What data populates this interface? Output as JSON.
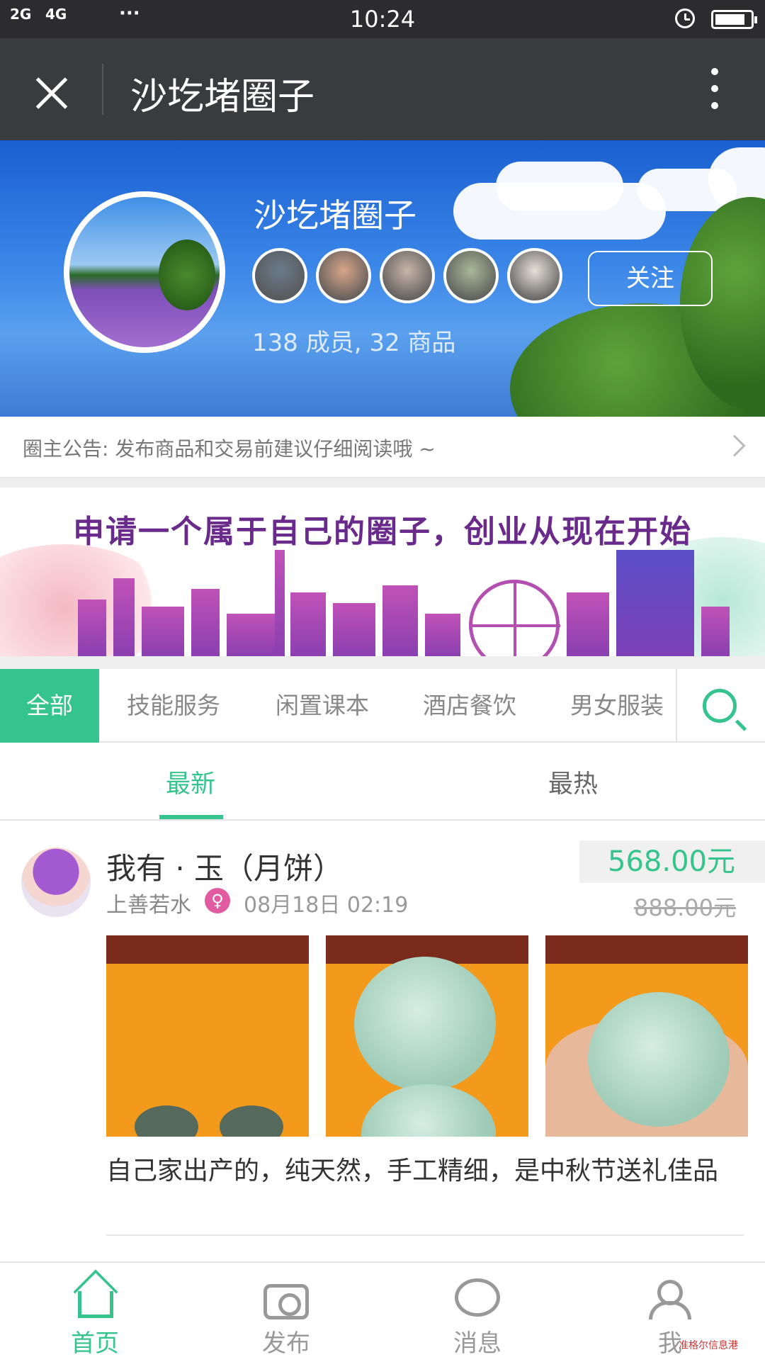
{
  "status_bar": {
    "signal_1": "2G",
    "signal_2": "4G",
    "dots": "···",
    "time": "10:24",
    "battery_level": 0.85
  },
  "title_bar": {
    "title": "沙圪堵圈子"
  },
  "hero": {
    "name": "沙圪堵圈子",
    "follow_label": "关注",
    "stats": "138 成员, 32 商品",
    "member_colors": [
      "#6b7b8c",
      "#d8a58a",
      "#c9b4a8",
      "#a8b898",
      "#e8e0d8"
    ]
  },
  "notice": {
    "text": "圈主公告: 发布商品和交易前建议仔细阅读哦 ~"
  },
  "banner": {
    "slogan": "申请一个属于自己的圈子，创业从现在开始"
  },
  "categories": {
    "items": [
      "全部",
      "技能服务",
      "闲置课本",
      "酒店餐饮",
      "男女服装"
    ],
    "active_index": 0
  },
  "sort_tabs": {
    "latest": "最新",
    "hottest": "最热",
    "active": "最新"
  },
  "post": {
    "title": "我有 · 玉（月饼）",
    "author": "上善若水",
    "gender_icon": "female-icon",
    "date": "08月18日 02:19",
    "price": "568.00元",
    "original_price": "888.00元",
    "description": "自己家出产的，纯天然，手工精细，是中秋节送礼佳品"
  },
  "tab_bar": {
    "home": "首页",
    "publish": "发布",
    "messages": "消息",
    "me": "我"
  },
  "watermark": "准格尔信息港",
  "colors": {
    "accent": "#35c48e",
    "title_bar": "#3a3b3f",
    "status_bar": "#2c2c2e"
  }
}
